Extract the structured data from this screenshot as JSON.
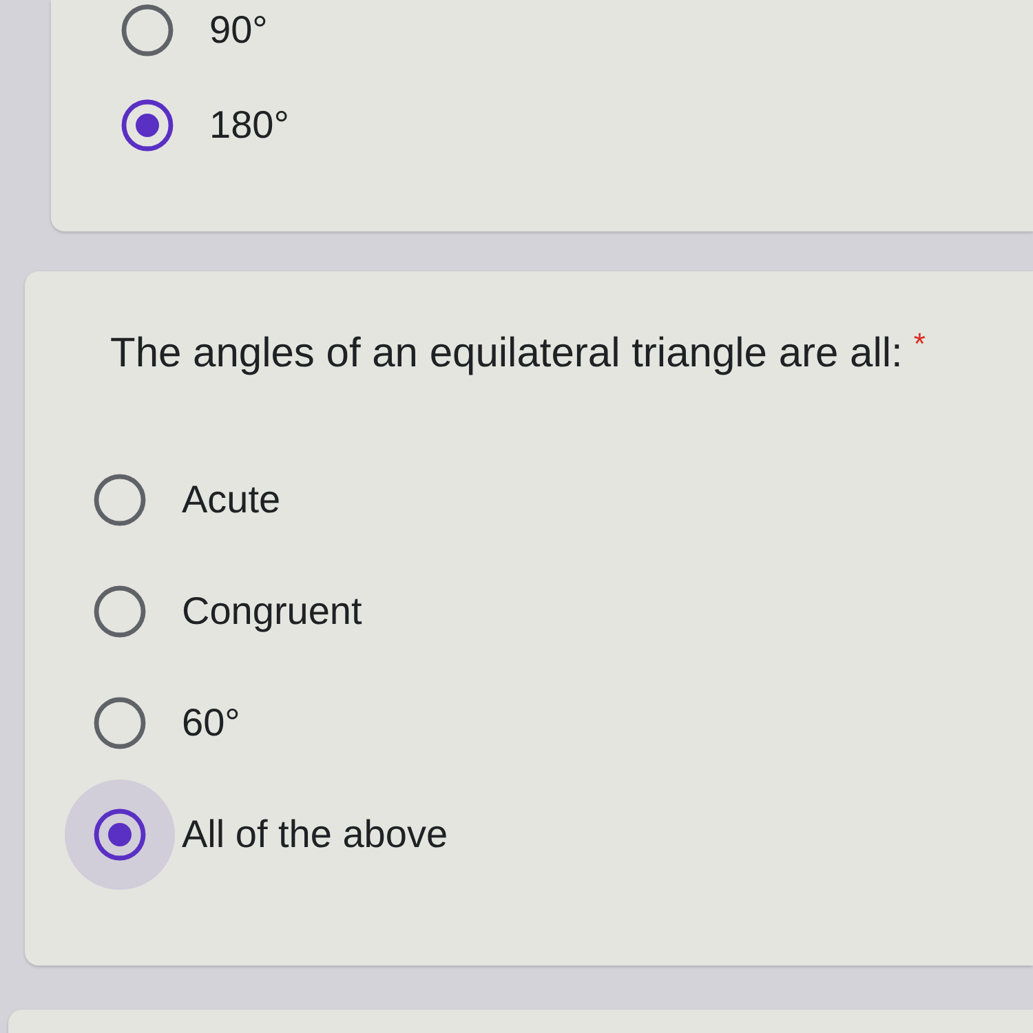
{
  "questions": [
    {
      "options": [
        {
          "label": "90°",
          "selected": false,
          "focused": false
        },
        {
          "label": "180°",
          "selected": true,
          "focused": false
        }
      ]
    },
    {
      "title": "The angles of an equilateral triangle are all:",
      "required_mark": "*",
      "options": [
        {
          "label": "Acute",
          "selected": false,
          "focused": false
        },
        {
          "label": "Congruent",
          "selected": false,
          "focused": false
        },
        {
          "label": "60°",
          "selected": false,
          "focused": false
        },
        {
          "label": "All of the above",
          "selected": true,
          "focused": true
        }
      ]
    }
  ]
}
